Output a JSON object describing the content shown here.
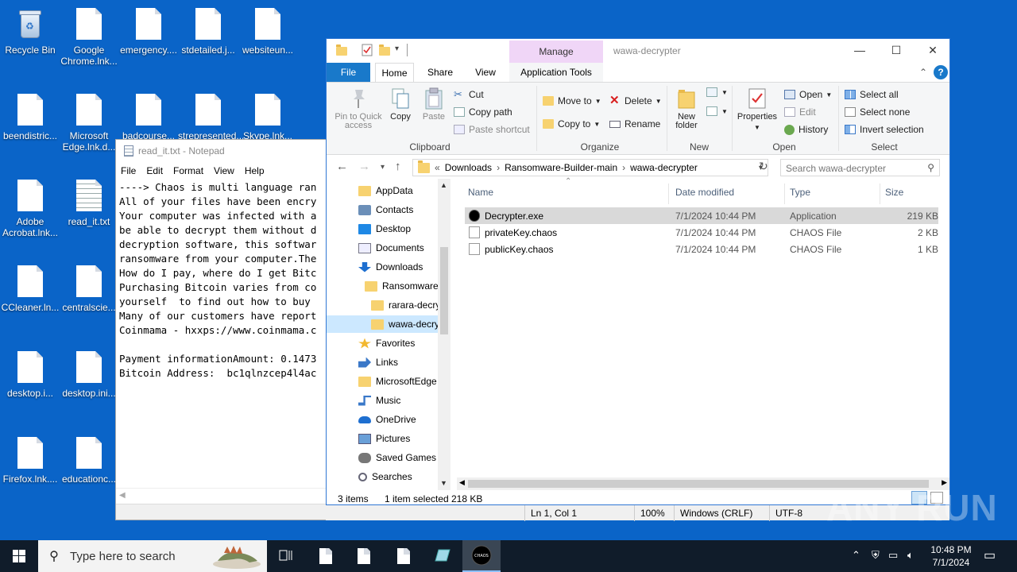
{
  "desktop": {
    "icons": [
      {
        "label": "Recycle Bin",
        "kind": "bin"
      },
      {
        "label": "Google Chrome.lnk...",
        "kind": "page"
      },
      {
        "label": "emergency....",
        "kind": "page"
      },
      {
        "label": "stdetailed.j...",
        "kind": "page"
      },
      {
        "label": "websiteun...",
        "kind": "page"
      },
      {
        "label": "beendistric...",
        "kind": "page"
      },
      {
        "label": "Microsoft Edge.lnk.d...",
        "kind": "page"
      },
      {
        "label": "badcourse...",
        "kind": "page"
      },
      {
        "label": "strepresented...",
        "kind": "page"
      },
      {
        "label": "Skype.lnk...",
        "kind": "page"
      },
      {
        "label": "Adobe Acrobat.lnk...",
        "kind": "page"
      },
      {
        "label": "read_it.txt",
        "kind": "txt"
      },
      {
        "label": "CCleaner.ln...",
        "kind": "page"
      },
      {
        "label": "centralscie...",
        "kind": "page"
      },
      {
        "label": "desktop.i...",
        "kind": "page"
      },
      {
        "label": "desktop.ini...",
        "kind": "page"
      },
      {
        "label": "Firefox.lnk....",
        "kind": "page"
      },
      {
        "label": "educationc...",
        "kind": "page"
      }
    ]
  },
  "notepad": {
    "title": "read_it.txt - Notepad",
    "menu": [
      "File",
      "Edit",
      "Format",
      "View",
      "Help"
    ],
    "lines": [
      "----> Chaos is multi language ran",
      "All of your files have been encry",
      "Your computer was infected with a",
      "be able to decrypt them without d",
      "decryption software, this softwar",
      "ransomware from your computer.The",
      "How do I pay, where do I get Bitc",
      "Purchasing Bitcoin varies from co",
      "yourself  to find out how to buy ",
      "Many of our customers have report",
      "Coinmama - hxxps://www.coinmama.c",
      "",
      "Payment informationAmount: 0.1473",
      "Bitcoin Address:  bc1qlnzcep4l4ac"
    ],
    "status": {
      "position": "Ln 1, Col 1",
      "zoom": "100%",
      "line_ending": "Windows (CRLF)",
      "encoding": "UTF-8"
    }
  },
  "explorer": {
    "manage_tab": "Manage",
    "title": "wawa-decrypter",
    "tabs": {
      "file": "File",
      "home": "Home",
      "share": "Share",
      "view": "View",
      "app_tools": "Application Tools"
    },
    "ribbon": {
      "clipboard": {
        "label": "Clipboard",
        "pin": "Pin to Quick access",
        "copy": "Copy",
        "paste": "Paste",
        "cut": "Cut",
        "copy_path": "Copy path",
        "paste_shortcut": "Paste shortcut"
      },
      "organize": {
        "label": "Organize",
        "move_to": "Move to",
        "copy_to": "Copy to",
        "delete": "Delete",
        "rename": "Rename"
      },
      "new": {
        "label": "New",
        "new_folder": "New folder"
      },
      "open": {
        "label": "Open",
        "properties": "Properties",
        "open": "Open",
        "edit": "Edit",
        "history": "History"
      },
      "select": {
        "label": "Select",
        "select_all": "Select all",
        "select_none": "Select none",
        "invert": "Invert selection"
      }
    },
    "address": {
      "crumbs": [
        "Downloads",
        "Ransomware-Builder-main",
        "wawa-decrypter"
      ],
      "search_placeholder": "Search wawa-decrypter"
    },
    "nav": [
      {
        "label": "AppData",
        "indent": 0,
        "icon": "folder"
      },
      {
        "label": "Contacts",
        "indent": 0,
        "icon": "contacts"
      },
      {
        "label": "Desktop",
        "indent": 0,
        "icon": "desktop"
      },
      {
        "label": "Documents",
        "indent": 0,
        "icon": "documents"
      },
      {
        "label": "Downloads",
        "indent": 0,
        "icon": "downloads"
      },
      {
        "label": "Ransomware-",
        "indent": 1,
        "icon": "folder"
      },
      {
        "label": "rarara-decry",
        "indent": 2,
        "icon": "folder"
      },
      {
        "label": "wawa-decry",
        "indent": 2,
        "icon": "folder",
        "selected": true
      },
      {
        "label": "Favorites",
        "indent": 0,
        "icon": "star"
      },
      {
        "label": "Links",
        "indent": 0,
        "icon": "links"
      },
      {
        "label": "MicrosoftEdge",
        "indent": 0,
        "icon": "folder"
      },
      {
        "label": "Music",
        "indent": 0,
        "icon": "music"
      },
      {
        "label": "OneDrive",
        "indent": 0,
        "icon": "cloud"
      },
      {
        "label": "Pictures",
        "indent": 0,
        "icon": "pictures"
      },
      {
        "label": "Saved Games",
        "indent": 0,
        "icon": "games"
      },
      {
        "label": "Searches",
        "indent": 0,
        "icon": "search"
      }
    ],
    "columns": [
      "Name",
      "Date modified",
      "Type",
      "Size"
    ],
    "files": [
      {
        "name": "Decrypter.exe",
        "date": "7/1/2024 10:44 PM",
        "type": "Application",
        "size": "219 KB",
        "selected": true
      },
      {
        "name": "privateKey.chaos",
        "date": "7/1/2024 10:44 PM",
        "type": "CHAOS File",
        "size": "2 KB"
      },
      {
        "name": "publicKey.chaos",
        "date": "7/1/2024 10:44 PM",
        "type": "CHAOS File",
        "size": "1 KB"
      }
    ],
    "status": {
      "items": "3 items",
      "selected": "1 item selected",
      "size": "218 KB"
    }
  },
  "watermark": "ANY RUN",
  "taskbar": {
    "search_placeholder": "Type here to search",
    "time": "10:48 PM",
    "date": "7/1/2024"
  }
}
